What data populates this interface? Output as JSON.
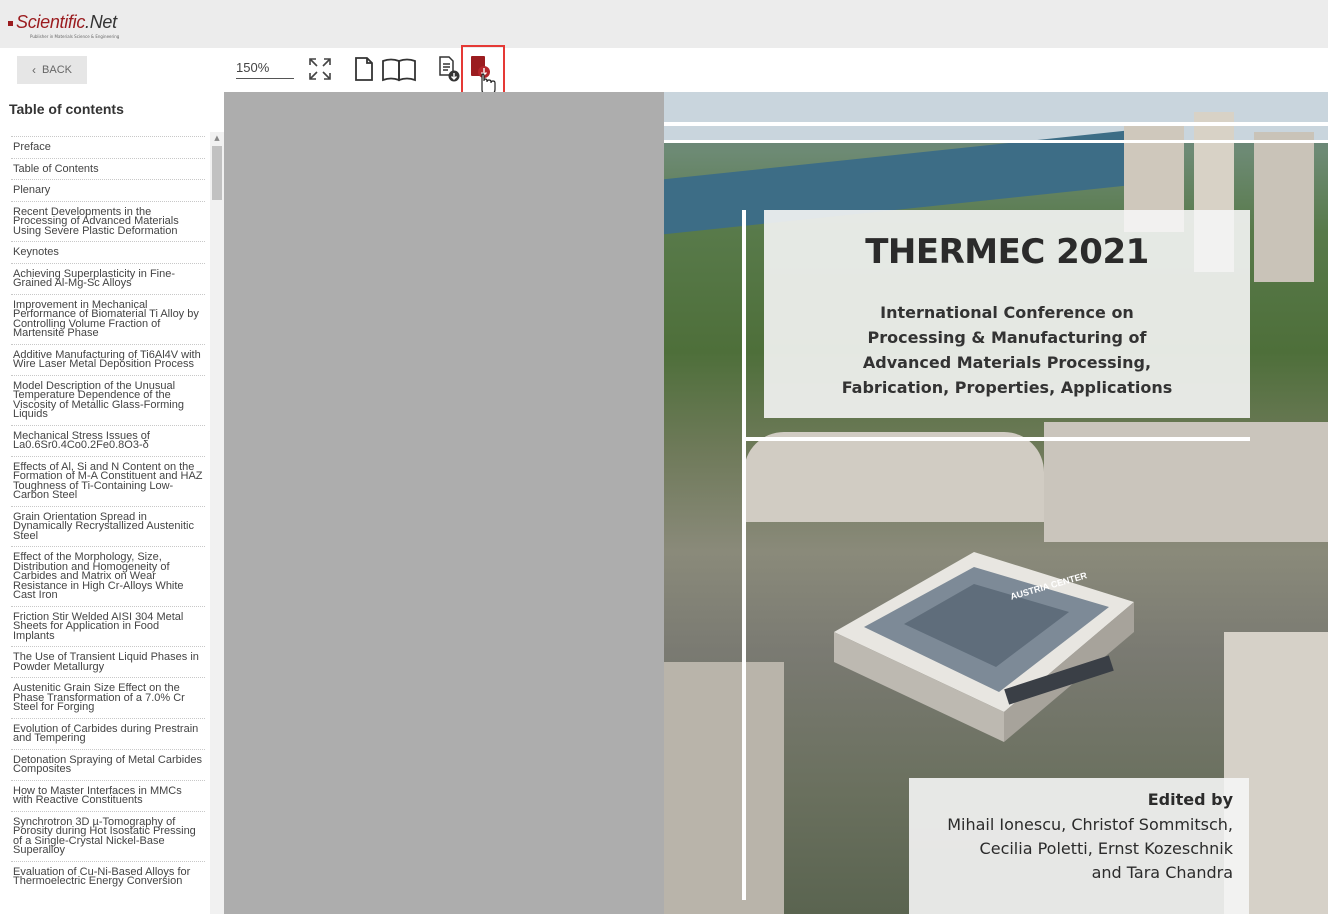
{
  "header": {
    "logo_name": "Scientific",
    "logo_dot": ".Net",
    "logo_tagline": "Publisher in Materials Science & Engineering"
  },
  "toolbar": {
    "back_label": "BACK",
    "zoom_value": "150%"
  },
  "sidebar": {
    "title": "Table of contents",
    "items": [
      "Preface",
      "Table of Contents",
      "Plenary",
      "Recent Developments in the Processing of Advanced Materials Using Severe Plastic Deformation",
      "Keynotes",
      "Achieving Superplasticity in Fine-Grained Al-Mg-Sc Alloys",
      "Improvement in Mechanical Performance of Biomaterial Ti Alloy by Controlling Volume Fraction of Martensite Phase",
      "Additive Manufacturing of Ti6Al4V with Wire Laser Metal Deposition Process",
      "Model Description of the Unusual Temperature Dependence of the Viscosity of Metallic Glass-Forming Liquids",
      "Mechanical Stress Issues of La0.6Sr0.4Co0.2Fe0.8O3-δ",
      "Effects of Al, Si and N Content on the Formation of M-A Constituent and HAZ Toughness of Ti-Containing Low-Carbon Steel",
      "Grain Orientation Spread in Dynamically Recrystallized Austenitic Steel",
      "Effect of the Morphology, Size, Distribution and Homogeneity of Carbides and Matrix on Wear Resistance in High Cr-Alloys White Cast Iron",
      "Friction Stir Welded AISI 304 Metal Sheets for Application in Food Implants",
      "The Use of Transient Liquid Phases in Powder Metallurgy",
      "Austenitic Grain Size Effect on the Phase Transformation of a 7.0% Cr Steel for Forging",
      "Evolution of Carbides during Prestrain and Tempering",
      "Detonation Spraying of Metal Carbides Composites",
      "How to Master Interfaces in MMCs with Reactive Constituents",
      "Synchrotron 3D µ-Tomography of Porosity during Hot Isostatic Pressing of a Single-Crystal Nickel-Base Superalloy",
      "Evaluation of Cu-Ni-Based Alloys for Thermoelectric Energy Conversion"
    ]
  },
  "cover": {
    "title": "THERMEC 2021",
    "subtitle_lines": [
      "International Conference on",
      "Processing & Manufacturing of",
      "Advanced Materials Processing,",
      "Fabrication, Properties, Applications"
    ],
    "edited_by": "Edited by",
    "editors_lines": [
      "Mihail Ionescu, Christof Sommitsch,",
      "Cecilia Poletti, Ernst Kozeschnik",
      "and Tara Chandra"
    ],
    "building_sign": "AUSTRIA CENTER"
  },
  "colors": {
    "brand": "#9b1c1f",
    "highlight": "#e53935",
    "viewer_bg": "#adadad"
  }
}
